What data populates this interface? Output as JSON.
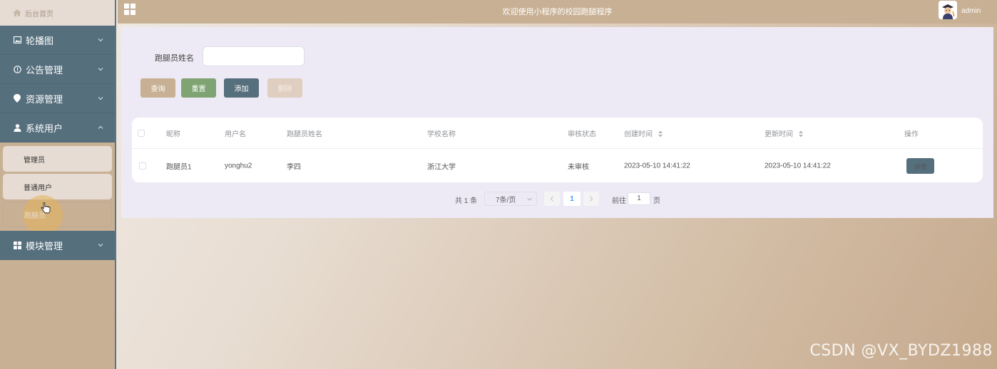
{
  "sidebar": {
    "home_label": "后台首页",
    "groups": [
      {
        "label": "轮播图",
        "icon": "image-icon",
        "arrow": "chevron-down-icon"
      },
      {
        "label": "公告管理",
        "icon": "info-circle-icon",
        "arrow": "chevron-down-icon"
      },
      {
        "label": "资源管理",
        "icon": "location-pin-icon",
        "arrow": "chevron-down-icon"
      },
      {
        "label": "系统用户",
        "icon": "user-icon",
        "arrow": "chevron-up-icon"
      },
      {
        "label": "模块管理",
        "icon": "grid-icon",
        "arrow": "chevron-down-icon"
      }
    ],
    "sub_items": [
      "管理员",
      "普通用户",
      "跑腿员"
    ],
    "active_sub_item": "跑腿员"
  },
  "header": {
    "title": "欢迎使用小程序的校园跑腿程序",
    "username": "admin"
  },
  "search": {
    "label": "跑腿员姓名",
    "value": "",
    "placeholder": ""
  },
  "toolbar": {
    "query_label": "查询",
    "reset_label": "重置",
    "add_label": "添加",
    "delete_label": "删除"
  },
  "table": {
    "columns": [
      "昵称",
      "用户名",
      "跑腿员姓名",
      "学校名称",
      "审核状态",
      "创建时间",
      "更新时间",
      "操作"
    ],
    "rows": [
      {
        "nickname": "跑腿员1",
        "username": "yonghu2",
        "runner_name": "李四",
        "school": "浙江大学",
        "status": "未审核",
        "created": "2023-05-10 14:41:22",
        "updated": "2023-05-10 14:41:22",
        "action_label": "详情"
      }
    ]
  },
  "pagination": {
    "total_text": "共 1 条",
    "page_size": "7条/页",
    "current_page": "1",
    "goto_label": "前往",
    "goto_value": "1",
    "page_suffix": "页"
  },
  "watermark": "CSDN @VX_BYDZ1988",
  "colors": {
    "accent": "#c8b094",
    "nav": "#566f7d",
    "success": "#7fa373",
    "panel": "#edeaf5"
  }
}
